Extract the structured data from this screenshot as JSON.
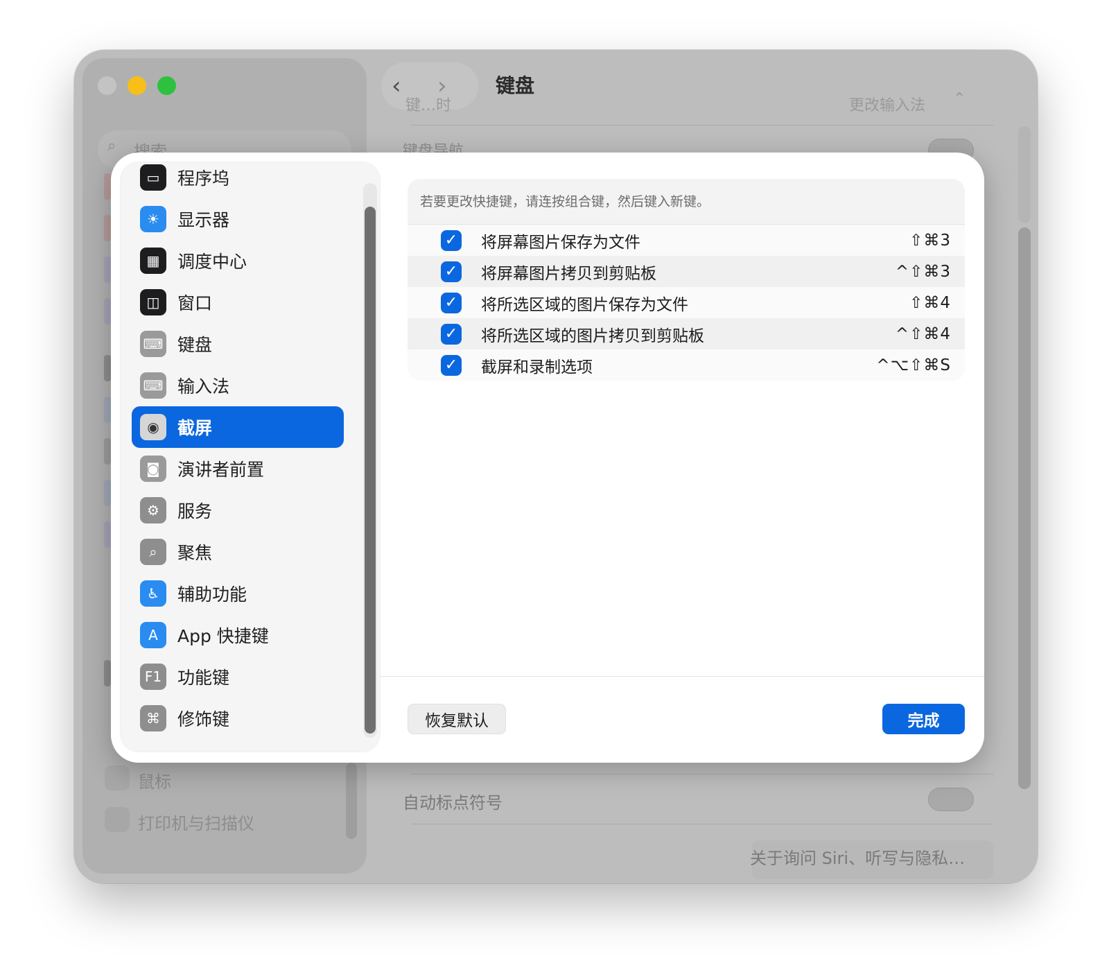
{
  "window": {
    "title": "键盘",
    "back_arrow": "‹",
    "forward_arrow": "›"
  },
  "background": {
    "sidebar": {
      "search_placeholder": "搜索",
      "items": [
        {
          "label": "鼠标"
        },
        {
          "label": "打印机与扫描仪"
        }
      ]
    },
    "content": {
      "row1_label": "键盘导航",
      "row1_partial": "键…时",
      "input_method_button": "更改输入法",
      "auto_punct_label": "自动标点符号",
      "siri_button": "关于询问 Siri、听写与隐私…"
    }
  },
  "sheet": {
    "sidebar": {
      "items": [
        {
          "label": "程序坞",
          "icon": "dock-icon",
          "color": "#1d1d1f"
        },
        {
          "label": "显示器",
          "icon": "sun-icon",
          "color": "#2a8cf0"
        },
        {
          "label": "调度中心",
          "icon": "mission-control-icon",
          "color": "#1d1d1f"
        },
        {
          "label": "窗口",
          "icon": "window-icon",
          "color": "#1d1d1f"
        },
        {
          "label": "键盘",
          "icon": "keyboard-icon",
          "color": "#9a9a9a"
        },
        {
          "label": "输入法",
          "icon": "keyboard-icon",
          "color": "#9a9a9a"
        },
        {
          "label": "截屏",
          "icon": "camera-icon",
          "color": "#d6d6d6",
          "selected": true
        },
        {
          "label": "演讲者前置",
          "icon": "presenter-icon",
          "color": "#9a9a9a"
        },
        {
          "label": "服务",
          "icon": "gears-icon",
          "color": "#8e8e8e"
        },
        {
          "label": "聚焦",
          "icon": "magnifier-icon",
          "color": "#8e8e8e"
        },
        {
          "label": "辅助功能",
          "icon": "accessibility-icon",
          "color": "#2a8cf0"
        },
        {
          "label": "App 快捷键",
          "icon": "app-store-icon",
          "color": "#2a8cf0"
        },
        {
          "label": "功能键",
          "icon": "f1-icon",
          "color": "#8e8e8e",
          "glyph": "F1"
        },
        {
          "label": "修饰键",
          "icon": "command-icon",
          "color": "#8e8e8e",
          "glyph": "⌘"
        }
      ]
    },
    "hint": "若要更改快捷键，请连按组合键，然后键入新键。",
    "shortcuts": [
      {
        "label": "将屏幕图片保存为文件",
        "keys": "⇧⌘3",
        "checked": true
      },
      {
        "label": "将屏幕图片拷贝到剪贴板",
        "keys": "^⇧⌘3",
        "checked": true
      },
      {
        "label": "将所选区域的图片保存为文件",
        "keys": "⇧⌘4",
        "checked": true
      },
      {
        "label": "将所选区域的图片拷贝到剪贴板",
        "keys": "^⇧⌘4",
        "checked": true
      },
      {
        "label": "截屏和录制选项",
        "keys": "^⌥⇧⌘S",
        "checked": true
      }
    ],
    "reset_button": "恢复默认",
    "done_button": "完成",
    "accent": "#0b67df"
  }
}
